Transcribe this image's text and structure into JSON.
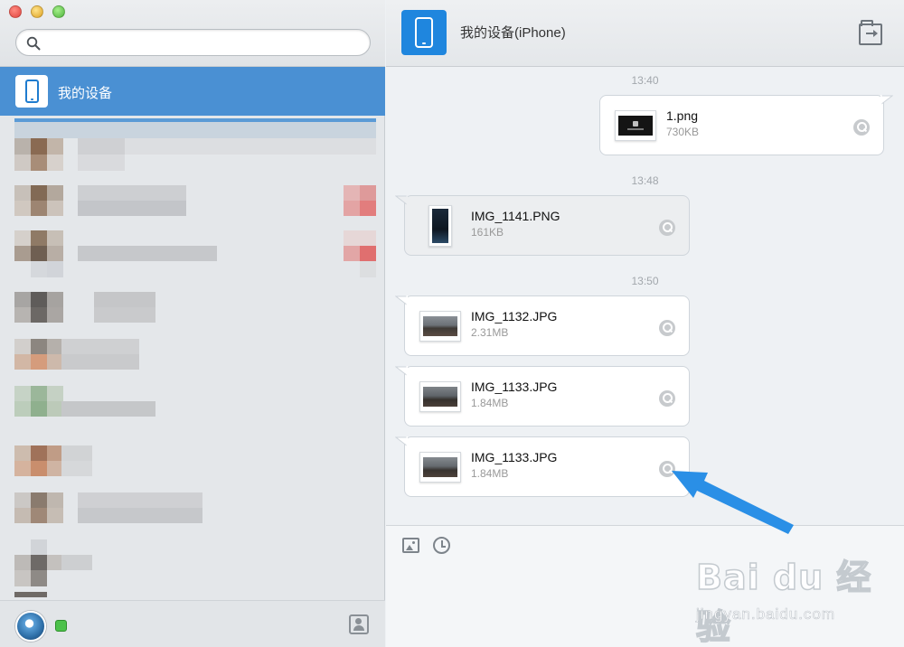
{
  "search": {
    "placeholder": "",
    "value": ""
  },
  "sidebar": {
    "selected_item": {
      "label": "我的设备"
    }
  },
  "header": {
    "title": "我的设备(iPhone)"
  },
  "messages": [
    {
      "time": "13:40",
      "direction": "outgoing",
      "file": "1.png",
      "size": "730KB"
    },
    {
      "time": "13:48",
      "direction": "incoming",
      "file": "IMG_1141.PNG",
      "size": "161KB"
    },
    {
      "time": "13:50",
      "direction": "incoming",
      "file": "IMG_1132.JPG",
      "size": "2.31MB"
    },
    {
      "time": "",
      "direction": "incoming",
      "file": "IMG_1133.JPG",
      "size": "1.84MB"
    },
    {
      "time": "",
      "direction": "incoming",
      "file": "IMG_1133.JPG",
      "size": "1.84MB"
    }
  ],
  "icons": {
    "search": "search-icon",
    "device": "iphone-icon",
    "send_file": "send-file-icon",
    "preview": "magnifier-preview-icon",
    "image_tool": "image-icon",
    "history": "clock-history-icon",
    "contacts": "contacts-icon",
    "status": "online-status-icon"
  },
  "colors": {
    "accent": "#4a90d3",
    "device_icon": "#1f86de",
    "status_online": "#4cc14a",
    "annotation_arrow": "#2a8fe6"
  },
  "watermark": {
    "logo": "Bai du 经验",
    "url": "jingyan.baidu.com"
  }
}
